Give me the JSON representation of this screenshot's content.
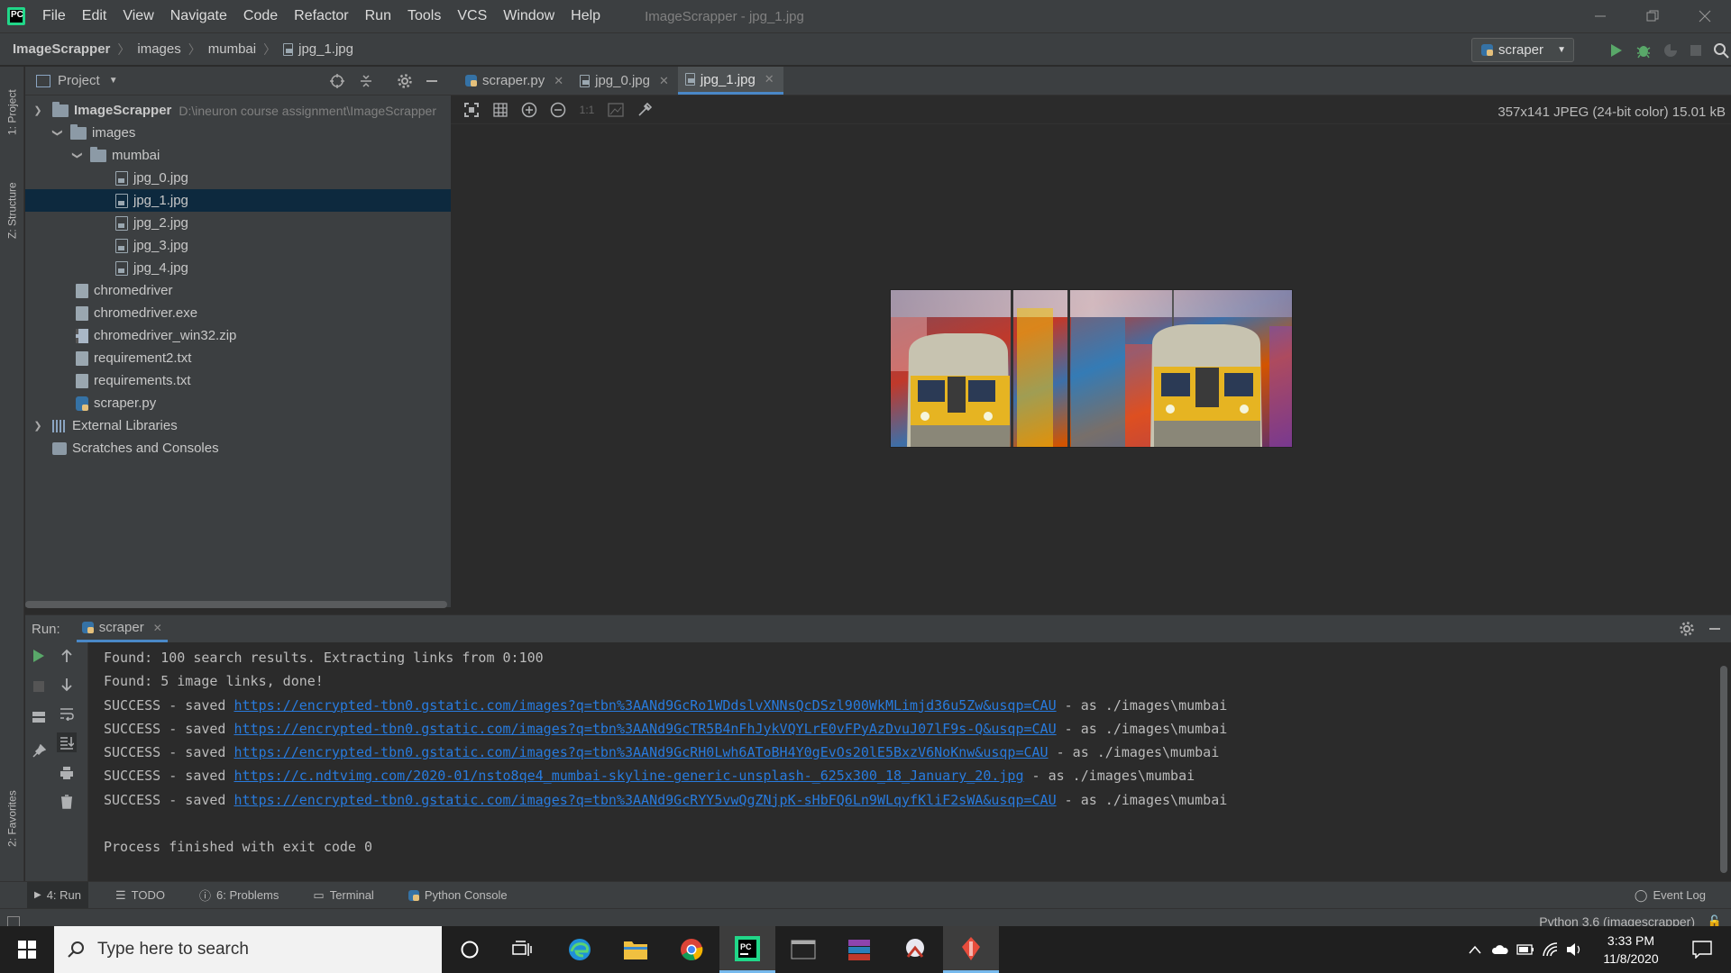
{
  "titlebar": {
    "menu": [
      "File",
      "Edit",
      "View",
      "Navigate",
      "Code",
      "Refactor",
      "Run",
      "Tools",
      "VCS",
      "Window",
      "Help"
    ],
    "window_title": "ImageScrapper - jpg_1.jpg"
  },
  "navbar": {
    "breadcrumb": [
      "ImageScrapper",
      "images",
      "mumbai",
      "jpg_1.jpg"
    ],
    "run_config": "scraper"
  },
  "left_stripe": {
    "tabs": [
      "1: Project",
      "Z: Structure",
      "2: Favorites"
    ]
  },
  "project": {
    "title": "Project",
    "root": {
      "name": "ImageScrapper",
      "path": "D:\\ineuron course assignment\\ImageScrapper"
    },
    "items": [
      {
        "label": "images"
      },
      {
        "label": "mumbai"
      },
      {
        "label": "jpg_0.jpg"
      },
      {
        "label": "jpg_1.jpg"
      },
      {
        "label": "jpg_2.jpg"
      },
      {
        "label": "jpg_3.jpg"
      },
      {
        "label": "jpg_4.jpg"
      },
      {
        "label": "chromedriver"
      },
      {
        "label": "chromedriver.exe"
      },
      {
        "label": "chromedriver_win32.zip"
      },
      {
        "label": "requirement2.txt"
      },
      {
        "label": "requirements.txt"
      },
      {
        "label": "scraper.py"
      },
      {
        "label": "External Libraries"
      },
      {
        "label": "Scratches and Consoles"
      }
    ]
  },
  "editor": {
    "tabs": [
      "scraper.py",
      "jpg_0.jpg",
      "jpg_1.jpg"
    ],
    "active_tab": "jpg_1.jpg",
    "image_info": "357x141 JPEG (24-bit color) 15.01 kB",
    "zoom_label": "1:1"
  },
  "run": {
    "label": "Run:",
    "tab": "scraper",
    "lines": [
      {
        "text": "Found: 100 search results. Extracting links from 0:100"
      },
      {
        "text": "Found: 5 image links, done!"
      },
      {
        "prefix": "SUCCESS - saved ",
        "link": "https://encrypted-tbn0.gstatic.com/images?q=tbn%3AANd9GcRo1WDdslvXNNsQcDSzl900WkMLimjd36u5Zw&usqp=CAU",
        "suffix": " - as ./images\\mumbai"
      },
      {
        "prefix": "SUCCESS - saved ",
        "link": "https://encrypted-tbn0.gstatic.com/images?q=tbn%3AANd9GcTR5B4nFhJykVQYLrE0vFPyAzDvuJ07lF9s-Q&usqp=CAU",
        "suffix": " - as ./images\\mumbai"
      },
      {
        "prefix": "SUCCESS - saved ",
        "link": "https://encrypted-tbn0.gstatic.com/images?q=tbn%3AANd9GcRH0Lwh6AToBH4Y0gEvOs20lE5BxzV6NoKnw&usqp=CAU",
        "suffix": " - as ./images\\mumbai"
      },
      {
        "prefix": "SUCCESS - saved ",
        "link": "https://c.ndtvimg.com/2020-01/nsto8qe4_mumbai-skyline-generic-unsplash-_625x300_18_January_20.jpg",
        "suffix": " - as ./images\\mumbai"
      },
      {
        "prefix": "SUCCESS - saved ",
        "link": "https://encrypted-tbn0.gstatic.com/images?q=tbn%3AANd9GcRYY5vwQgZNjpK-sHbFQ6Ln9WLqyfKliF2sWA&usqp=CAU",
        "suffix": " - as ./images\\mumbai"
      },
      {
        "text": ""
      },
      {
        "text": "Process finished with exit code 0"
      }
    ]
  },
  "bottom_tools": [
    "4: Run",
    "TODO",
    "6: Problems",
    "Terminal",
    "Python Console"
  ],
  "event_log": "Event Log",
  "status": {
    "interpreter": "Python 3.6 (imagescrapper)"
  },
  "taskbar": {
    "search_placeholder": "Type here to search",
    "time": "3:33 PM",
    "date": "11/8/2020"
  },
  "colors": {
    "accent": "#4a88c7",
    "link": "#287bde",
    "run_green": "#59a869",
    "selection": "#0d293e"
  }
}
